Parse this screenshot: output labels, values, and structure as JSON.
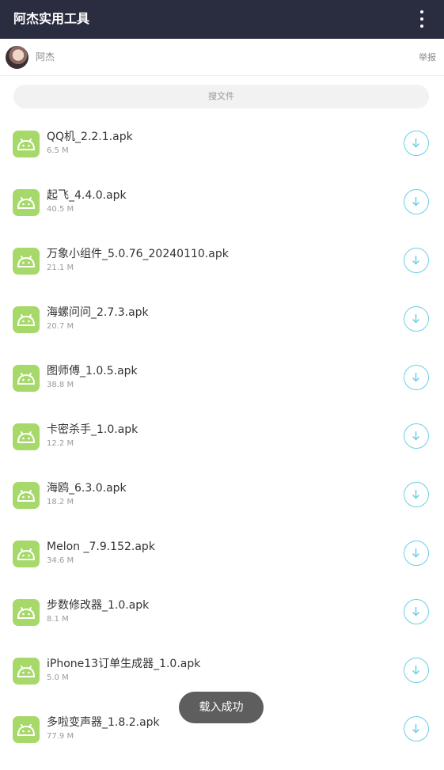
{
  "header": {
    "title": "阿杰实用工具",
    "menu_icon": "more-vertical-icon"
  },
  "user": {
    "name": "阿杰",
    "report_label": "举报",
    "avatar_icon": "user-avatar"
  },
  "search": {
    "placeholder": "搜文件"
  },
  "files": [
    {
      "name": "QQ机_2.2.1.apk",
      "size": "6.5 M"
    },
    {
      "name": "起飞_4.4.0.apk",
      "size": "40.5 M"
    },
    {
      "name": "万象小组件_5.0.76_20240110.apk",
      "size": "21.1 M"
    },
    {
      "name": "海螺问问_2.7.3.apk",
      "size": "20.7 M"
    },
    {
      "name": "图师傅_1.0.5.apk",
      "size": "38.8 M"
    },
    {
      "name": "卡密杀手_1.0.apk",
      "size": "12.2 M"
    },
    {
      "name": "海鸥_6.3.0.apk",
      "size": "18.2 M"
    },
    {
      "name": "Melon _7.9.152.apk",
      "size": "34.6 M"
    },
    {
      "name": "步数修改器_1.0.apk",
      "size": "8.1 M"
    },
    {
      "name": "iPhone13订单生成器_1.0.apk",
      "size": "5.0 M"
    },
    {
      "name": "多啦变声器_1.8.2.apk",
      "size": "77.9 M"
    }
  ],
  "toast": {
    "text": "载入成功"
  },
  "colors": {
    "header_bg": "#2a2c40",
    "apk_icon": "#a6d96a",
    "download_accent": "#6ccfe6"
  }
}
